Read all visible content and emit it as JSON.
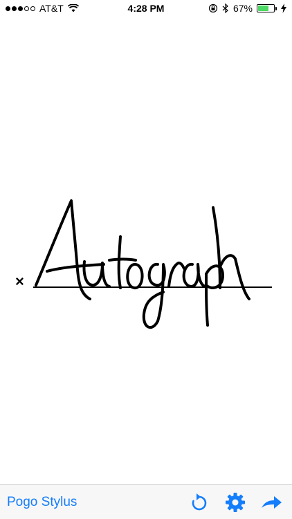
{
  "status_bar": {
    "carrier": "AT&T",
    "time": "4:28 PM",
    "battery_percent": "67%",
    "battery_level": 0.67,
    "signal_bars_filled": 3,
    "signal_bars_total": 5
  },
  "signature": {
    "mark": "×",
    "handwritten_text": "Autograph"
  },
  "toolbar": {
    "device_label": "Pogo Stylus",
    "accent_color": "#157efb",
    "buttons": [
      {
        "icon": "refresh-icon"
      },
      {
        "icon": "gear-icon"
      },
      {
        "icon": "share-arrow-icon"
      }
    ]
  }
}
